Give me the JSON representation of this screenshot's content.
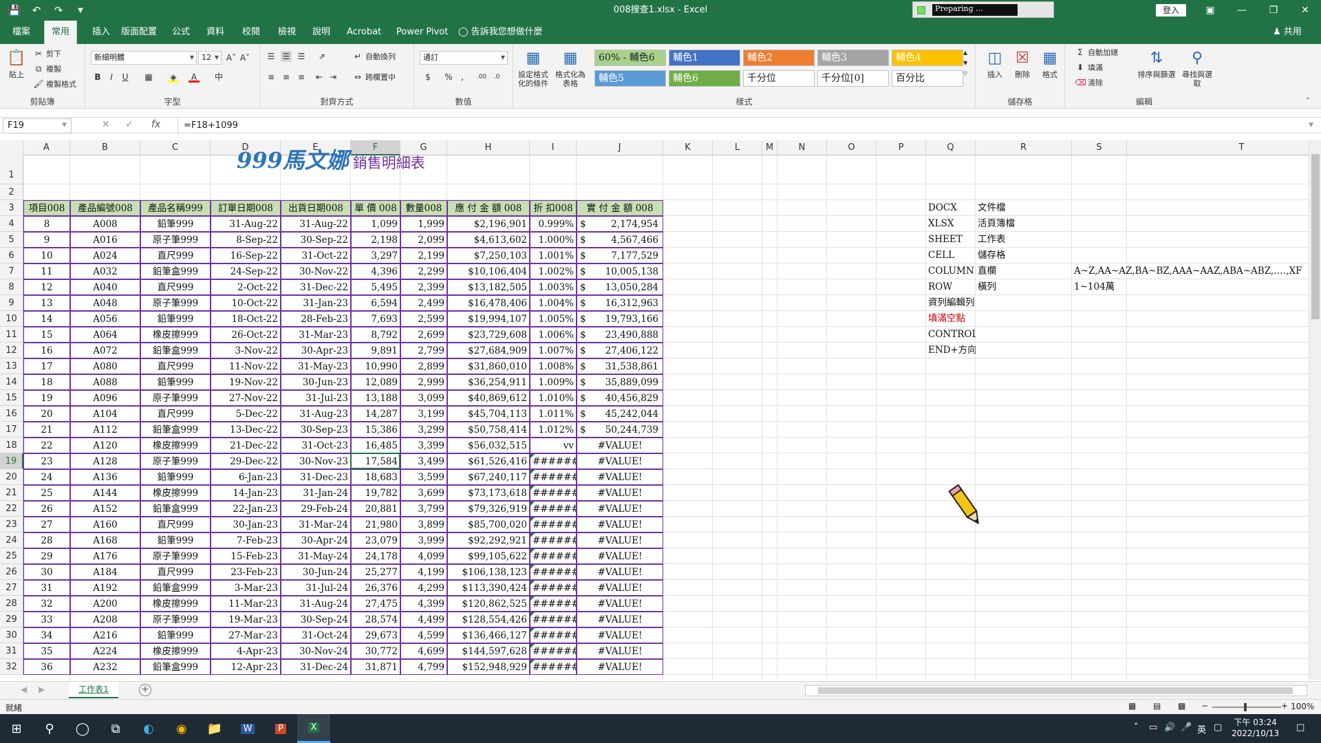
{
  "window": {
    "title": "008搜查1.xlsx - Excel",
    "preparing": "Preparing ...",
    "signin": "登入"
  },
  "menu": {
    "tabs": [
      "檔案",
      "常用",
      "插入",
      "版面配置",
      "公式",
      "資料",
      "校閱",
      "檢視",
      "說明",
      "Acrobat",
      "Power Pivot"
    ],
    "active": "常用",
    "tellme": "告訴我您想做什麼",
    "share": "共用"
  },
  "ribbon": {
    "clipboard": {
      "label": "剪貼簿",
      "paste": "貼上",
      "cut": "剪下",
      "copy": "複製",
      "format_painter": "複製格式"
    },
    "font": {
      "label": "字型",
      "name": "新細明體",
      "size": "12"
    },
    "alignment": {
      "label": "對齊方式",
      "wrap": "自動換列",
      "merge": "跨欄置中"
    },
    "number": {
      "label": "數值",
      "format": "通訂"
    },
    "styles": {
      "label": "樣式",
      "conditional": "設定格式化的條件",
      "table": "格式化為表格",
      "tiles": [
        {
          "text": "60% - 輔色6",
          "bg": "#a9d18e",
          "fg": "#222222"
        },
        {
          "text": "輔色1",
          "bg": "#4472c4",
          "fg": "#ffffff"
        },
        {
          "text": "輔色2",
          "bg": "#ed7d31",
          "fg": "#ffffff"
        },
        {
          "text": "輔色3",
          "bg": "#a5a5a5",
          "fg": "#ffffff"
        },
        {
          "text": "輔色4",
          "bg": "#ffc000",
          "fg": "#ffffff"
        },
        {
          "text": "輔色5",
          "bg": "#5b9bd5",
          "fg": "#ffffff"
        },
        {
          "text": "輔色6",
          "bg": "#70ad47",
          "fg": "#ffffff"
        },
        {
          "text": "千分位",
          "bg": "#ffffff",
          "fg": "#222222"
        },
        {
          "text": "千分位[0]",
          "bg": "#ffffff",
          "fg": "#222222"
        },
        {
          "text": "百分比",
          "bg": "#ffffff",
          "fg": "#222222"
        }
      ]
    },
    "cells": {
      "label": "儲存格",
      "insert": "插入",
      "delete": "刪除",
      "format": "格式"
    },
    "editing": {
      "label": "編輯",
      "autosum": "自動加總",
      "fill": "填滿",
      "clear": "清除",
      "sort": "排序與篩選",
      "find": "尋找與選取"
    }
  },
  "formula_bar": {
    "namebox": "F19",
    "formula": "=F18+1099",
    "fx": "fx"
  },
  "columns": [
    "A",
    "B",
    "C",
    "D",
    "E",
    "F",
    "G",
    "H",
    "I",
    "J",
    "K",
    "L",
    "M",
    "N",
    "O",
    "P",
    "Q",
    "R",
    "S",
    "T"
  ],
  "rows": [
    "1",
    "2",
    "3",
    "4",
    "5",
    "6",
    "7",
    "8",
    "9",
    "10",
    "11",
    "12",
    "13",
    "14",
    "15",
    "16",
    "17",
    "18",
    "19",
    "20",
    "21",
    "22",
    "23",
    "24",
    "25",
    "26",
    "27",
    "28",
    "29",
    "30",
    "31",
    "32"
  ],
  "selected": {
    "column": "F",
    "row": "19"
  },
  "sheet_title": {
    "main": "999馬文娜",
    "sub": "銷售明細表",
    "main_color": "#2e75b6",
    "sub_color": "#7030a0"
  },
  "table_headers": [
    "項目008",
    "產品編號008",
    "產品名稱999",
    "訂單日期008",
    "出貨日期008",
    "單 價 008",
    "數量008",
    "應 付 金 額 008",
    "折 扣008",
    "實 付 金 額 008"
  ],
  "table_rows": [
    [
      "8",
      "A008",
      "鉛筆999",
      "31-Aug-22",
      "31-Aug-22",
      "1,099",
      "1,999",
      "$2,196,901",
      "0.999%",
      "$",
      "2,174,954"
    ],
    [
      "9",
      "A016",
      "原子筆999",
      "8-Sep-22",
      "30-Sep-22",
      "2,198",
      "2,099",
      "$4,613,602",
      "1.000%",
      "$",
      "4,567,466"
    ],
    [
      "10",
      "A024",
      "直尺999",
      "16-Sep-22",
      "31-Oct-22",
      "3,297",
      "2,199",
      "$7,250,103",
      "1.001%",
      "$",
      "7,177,529"
    ],
    [
      "11",
      "A032",
      "鉛筆盒999",
      "24-Sep-22",
      "30-Nov-22",
      "4,396",
      "2,299",
      "$10,106,404",
      "1.002%",
      "$",
      "10,005,138"
    ],
    [
      "12",
      "A040",
      "直尺999",
      "2-Oct-22",
      "31-Dec-22",
      "5,495",
      "2,399",
      "$13,182,505",
      "1.003%",
      "$",
      "13,050,284"
    ],
    [
      "13",
      "A048",
      "原子筆999",
      "10-Oct-22",
      "31-Jan-23",
      "6,594",
      "2,499",
      "$16,478,406",
      "1.004%",
      "$",
      "16,312,963"
    ],
    [
      "14",
      "A056",
      "鉛筆999",
      "18-Oct-22",
      "28-Feb-23",
      "7,693",
      "2,599",
      "$19,994,107",
      "1.005%",
      "$",
      "19,793,166"
    ],
    [
      "15",
      "A064",
      "橡皮擦999",
      "26-Oct-22",
      "31-Mar-23",
      "8,792",
      "2,699",
      "$23,729,608",
      "1.006%",
      "$",
      "23,490,888"
    ],
    [
      "16",
      "A072",
      "鉛筆盒999",
      "3-Nov-22",
      "30-Apr-23",
      "9,891",
      "2,799",
      "$27,684,909",
      "1.007%",
      "$",
      "27,406,122"
    ],
    [
      "17",
      "A080",
      "直尺999",
      "11-Nov-22",
      "31-May-23",
      "10,990",
      "2,899",
      "$31,860,010",
      "1.008%",
      "$",
      "31,538,861"
    ],
    [
      "18",
      "A088",
      "鉛筆999",
      "19-Nov-22",
      "30-Jun-23",
      "12,089",
      "2,999",
      "$36,254,911",
      "1.009%",
      "$",
      "35,889,099"
    ],
    [
      "19",
      "A096",
      "原子筆999",
      "27-Nov-22",
      "31-Jul-23",
      "13,188",
      "3,099",
      "$40,869,612",
      "1.010%",
      "$",
      "40,456,829"
    ],
    [
      "20",
      "A104",
      "直尺999",
      "5-Dec-22",
      "31-Aug-23",
      "14,287",
      "3,199",
      "$45,704,113",
      "1.011%",
      "$",
      "45,242,044"
    ],
    [
      "21",
      "A112",
      "鉛筆盒999",
      "13-Dec-22",
      "30-Sep-23",
      "15,386",
      "3,299",
      "$50,758,414",
      "1.012%",
      "$",
      "50,244,739"
    ],
    [
      "22",
      "A120",
      "橡皮擦999",
      "21-Dec-22",
      "31-Oct-23",
      "16,485",
      "3,399",
      "$56,032,515",
      "vv",
      "",
      "#VALUE!"
    ],
    [
      "23",
      "A128",
      "原子筆999",
      "29-Dec-22",
      "30-Nov-23",
      "17,584",
      "3,499",
      "$61,526,416",
      "#######",
      "",
      "#VALUE!"
    ],
    [
      "24",
      "A136",
      "鉛筆999",
      "6-Jan-23",
      "31-Dec-23",
      "18,683",
      "3,599",
      "$67,240,117",
      "#######",
      "",
      "#VALUE!"
    ],
    [
      "25",
      "A144",
      "橡皮擦999",
      "14-Jan-23",
      "31-Jan-24",
      "19,782",
      "3,699",
      "$73,173,618",
      "#######",
      "",
      "#VALUE!"
    ],
    [
      "26",
      "A152",
      "鉛筆盒999",
      "22-Jan-23",
      "29-Feb-24",
      "20,881",
      "3,799",
      "$79,326,919",
      "#######",
      "",
      "#VALUE!"
    ],
    [
      "27",
      "A160",
      "直尺999",
      "30-Jan-23",
      "31-Mar-24",
      "21,980",
      "3,899",
      "$85,700,020",
      "#######",
      "",
      "#VALUE!"
    ],
    [
      "28",
      "A168",
      "鉛筆999",
      "7-Feb-23",
      "30-Apr-24",
      "23,079",
      "3,999",
      "$92,292,921",
      "#######",
      "",
      "#VALUE!"
    ],
    [
      "29",
      "A176",
      "原子筆999",
      "15-Feb-23",
      "31-May-24",
      "24,178",
      "4,099",
      "$99,105,622",
      "#######",
      "",
      "#VALUE!"
    ],
    [
      "30",
      "A184",
      "直尺999",
      "23-Feb-23",
      "30-Jun-24",
      "25,277",
      "4,199",
      "$106,138,123",
      "#######",
      "",
      "#VALUE!"
    ],
    [
      "31",
      "A192",
      "鉛筆盒999",
      "3-Mar-23",
      "31-Jul-24",
      "26,376",
      "4,299",
      "$113,390,424",
      "#######",
      "",
      "#VALUE!"
    ],
    [
      "32",
      "A200",
      "橡皮擦999",
      "11-Mar-23",
      "31-Aug-24",
      "27,475",
      "4,399",
      "$120,862,525",
      "#######",
      "",
      "#VALUE!"
    ],
    [
      "33",
      "A208",
      "原子筆999",
      "19-Mar-23",
      "30-Sep-24",
      "28,574",
      "4,499",
      "$128,554,426",
      "#######",
      "",
      "#VALUE!"
    ],
    [
      "34",
      "A216",
      "鉛筆999",
      "27-Mar-23",
      "31-Oct-24",
      "29,673",
      "4,599",
      "$136,466,127",
      "#######",
      "",
      "#VALUE!"
    ],
    [
      "35",
      "A224",
      "橡皮擦999",
      "4-Apr-23",
      "30-Nov-24",
      "30,772",
      "4,699",
      "$144,597,628",
      "#######",
      "",
      "#VALUE!"
    ],
    [
      "36",
      "A232",
      "鉛筆盒999",
      "12-Apr-23",
      "31-Dec-24",
      "31,871",
      "4,799",
      "$152,948,929",
      "#######",
      "",
      "#VALUE!"
    ]
  ],
  "notes": [
    {
      "q": "DOCX",
      "r": "文件檔",
      "s": "",
      "color": "#111111"
    },
    {
      "q": "XLSX",
      "r": "活頁簿檔",
      "s": "",
      "color": "#111111"
    },
    {
      "q": "SHEET",
      "r": "工作表",
      "s": "",
      "color": "#111111"
    },
    {
      "q": "CELL",
      "r": "儲存格",
      "s": "",
      "color": "#111111"
    },
    {
      "q": "COLUMN",
      "r": "直欄",
      "s": "A~Z,AA~AZ,BA~BZ,AAA~AAZ,ABA~ABZ,‥‥,XF",
      "color": "#111111"
    },
    {
      "q": "ROW",
      "r": "橫列",
      "s": "1~104萬",
      "color": "#111111"
    },
    {
      "q": "資列編輯列",
      "r": "",
      "s": "",
      "color": "#111111"
    },
    {
      "q": "填滿空點",
      "r": "",
      "s": "",
      "color": "#c00000"
    },
    {
      "q": "CONTROL+HOME",
      "r": "",
      "s": "",
      "color": "#111111"
    },
    {
      "q": "END+方向鍵",
      "r": "",
      "s": "",
      "color": "#111111"
    }
  ],
  "sheet_tabs": {
    "active": "工作表1"
  },
  "status": {
    "ready": "就緒",
    "zoom": "100%"
  },
  "taskbar": {
    "time": "下午 03:24",
    "date": "2022/10/13",
    "ime": "英"
  }
}
